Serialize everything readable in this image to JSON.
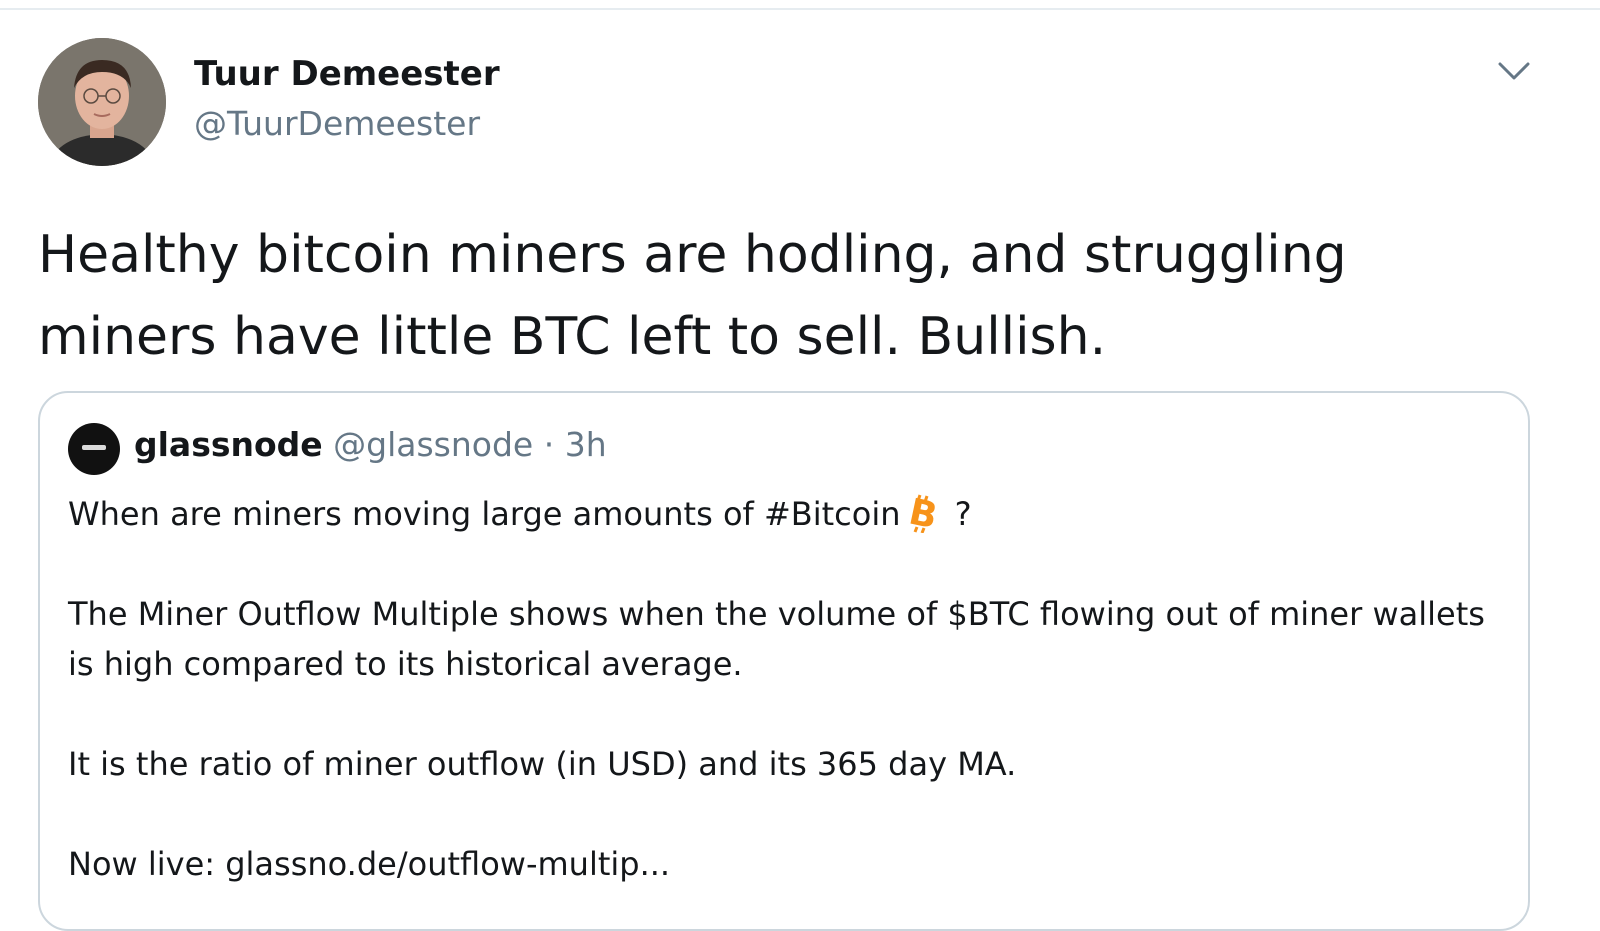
{
  "tweet": {
    "author_name": "Tuur Demeester",
    "author_handle": "@TuurDemeester",
    "text": "Healthy bitcoin miners are hodling, and struggling miners have little BTC left to sell. Bullish."
  },
  "quoted_tweet": {
    "author_name": "glassnode",
    "author_handle": "@glassnode",
    "separator": "·",
    "time": "3h",
    "line1_before_icon": "When are miners moving large amounts of #Bitcoin",
    "line1_after_icon": " ?",
    "paragraph2": "The Miner Outflow Multiple shows when the volume of $BTC flowing out of miner wallets is high compared to its historical average.",
    "paragraph3": "It is the ratio of miner outflow (in USD) and its 365 day MA.",
    "paragraph4": "Now live: glassno.de/outflow-multip..."
  },
  "icons": {
    "caret": "chevron-down-icon",
    "bitcoin": "bitcoin-icon"
  },
  "colors": {
    "text_primary": "#14171a",
    "text_secondary": "#657786",
    "border": "#ccd6dd",
    "bitcoin_orange": "#f7931a"
  }
}
